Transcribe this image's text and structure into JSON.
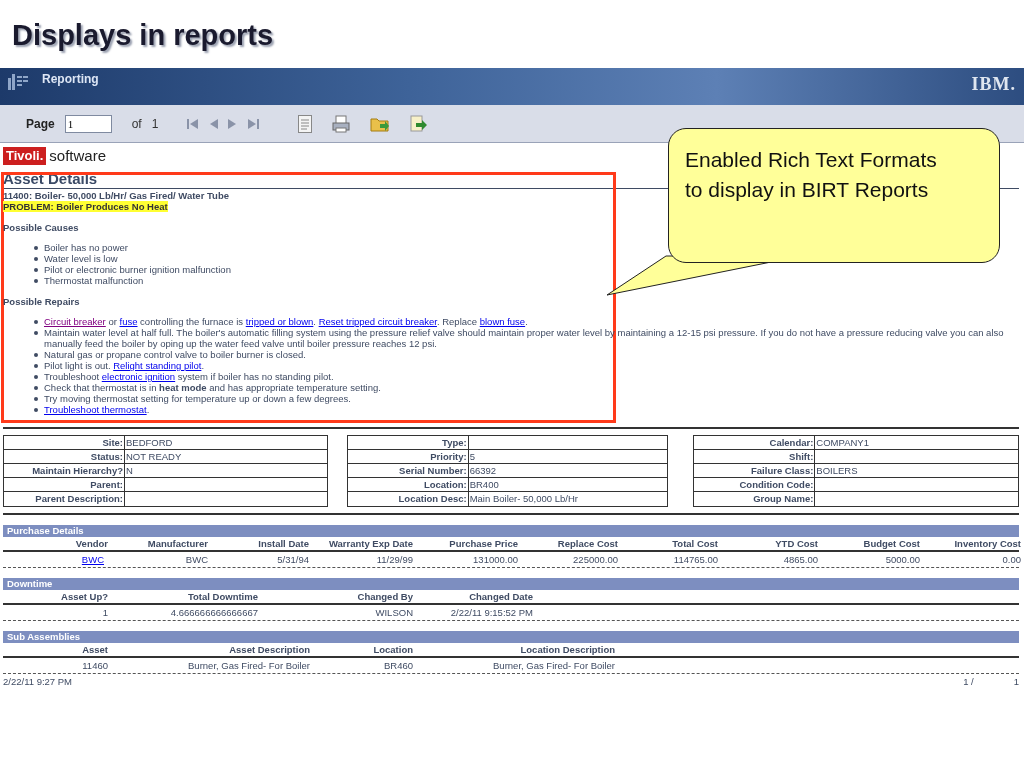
{
  "slide_title": "Displays in reports",
  "banner": {
    "title": "Reporting",
    "logo": "IBM."
  },
  "toolbar": {
    "page_label": "Page",
    "page_value": "1",
    "of_label": "of",
    "page_count": "1"
  },
  "report": {
    "brand": {
      "mark": "Tivoli.",
      "name": "software"
    },
    "title": "Asset Details",
    "asset": "11400: Boiler- 50,000 Lb/Hr/ Gas Fired/ Water Tube",
    "problem": "PROBLEM: Boiler Produces No Heat",
    "causes": {
      "heading": "Possible Causes",
      "items": [
        "Boiler has no power",
        "Water level is low",
        "Pilot or electronic burner ignition malfunction",
        "Thermostat malfunction"
      ]
    },
    "repairs": {
      "heading": "Possible Repairs",
      "items": [
        [
          {
            "kind": "link",
            "text": "Circuit breaker",
            "visited": true
          },
          {
            "kind": "text",
            "text": " or "
          },
          {
            "kind": "link",
            "text": "fuse",
            "visited": false
          },
          {
            "kind": "text",
            "text": " controlling the furnace is "
          },
          {
            "kind": "link",
            "text": "tripped or blown",
            "visited": false
          },
          {
            "kind": "text",
            "text": ". "
          },
          {
            "kind": "link",
            "text": "Reset tripped circuit breaker",
            "visited": false
          },
          {
            "kind": "text",
            "text": ". Replace "
          },
          {
            "kind": "link",
            "text": "blown fuse",
            "visited": false
          },
          {
            "kind": "text",
            "text": "."
          }
        ],
        [
          {
            "kind": "text",
            "text": "Maintain water level at half full. The boiler's automatic filling system using the pressure relief valve should maintain proper water level by maintaining a 12-15 psi pressure. If you do not have a pressure reducing valve you can also manually feed the boiler by oping up the water feed valve until boiler pressure reaches 12 psi."
          }
        ],
        [
          {
            "kind": "text",
            "text": "Natural gas or propane control valve to boiler burner is closed."
          }
        ],
        [
          {
            "kind": "text",
            "text": "Pilot light is out. "
          },
          {
            "kind": "link",
            "text": "Relight standing pilot",
            "visited": false
          },
          {
            "kind": "text",
            "text": "."
          }
        ],
        [
          {
            "kind": "text",
            "text": "Troubleshoot "
          },
          {
            "kind": "link",
            "text": "electronic ignition",
            "visited": false
          },
          {
            "kind": "text",
            "text": " system if boiler has no standing pilot."
          }
        ],
        [
          {
            "kind": "text",
            "text": "Check that thermostat is in "
          },
          {
            "kind": "bold",
            "text": "heat mode"
          },
          {
            "kind": "text",
            "text": " and has appropriate temperature setting."
          }
        ],
        [
          {
            "kind": "text",
            "text": "Try moving thermostat setting for temperature up or down a few degrees."
          }
        ],
        [
          {
            "kind": "link",
            "text": "Troubleshoot thermostat",
            "visited": false
          },
          {
            "kind": "text",
            "text": "."
          }
        ]
      ]
    },
    "fields": [
      [
        {
          "label": "Site:",
          "value": "BEDFORD"
        },
        {
          "label": "Status:",
          "value": "NOT READY"
        },
        {
          "label": "Maintain Hierarchy?",
          "value": "N"
        },
        {
          "label": "Parent:"
        },
        {
          "label": "Parent Description:"
        }
      ],
      [
        {
          "label": "Type:"
        },
        {
          "label": "Priority:",
          "value": "5"
        },
        {
          "label": "Serial Number:",
          "value": "66392"
        },
        {
          "label": "Location:",
          "value": "BR400"
        },
        {
          "label": "Location Desc:",
          "value": "Main Boiler- 50,000 Lb/Hr"
        }
      ],
      [
        {
          "label": "Calendar:",
          "value": "COMPANY1"
        },
        {
          "label": "Shift:"
        },
        {
          "label": "Failure Class:",
          "value": "BOILERS"
        },
        {
          "label": "Condition Code:"
        },
        {
          "label": "Group Name:"
        }
      ]
    ],
    "sections": [
      {
        "title": "Purchase Details",
        "columns": [
          {
            "label": "Vendor",
            "kind": "link"
          },
          {
            "label": "Manufacturer",
            "kind": "text"
          },
          {
            "label": "Install Date",
            "kind": "text"
          },
          {
            "label": "Warranty Exp Date",
            "kind": "text"
          },
          {
            "label": "Purchase Price",
            "kind": "text"
          },
          {
            "label": "Replace Cost",
            "kind": "text"
          },
          {
            "label": "Total Cost",
            "kind": "text"
          },
          {
            "label": "YTD Cost",
            "kind": "text"
          },
          {
            "label": "Budget Cost",
            "kind": "text"
          },
          {
            "label": "Inventory Cost",
            "kind": "text"
          }
        ],
        "rows": [
          [
            "BWC",
            "BWC",
            "5/31/94",
            "11/29/99",
            "131000.00",
            "225000.00",
            "114765.00",
            "4865.00",
            "5000.00",
            "0.00"
          ]
        ]
      },
      {
        "title": "Downtime",
        "columns": [
          {
            "label": "Asset Up?",
            "kind": "text"
          },
          {
            "label": "Total Downtime",
            "kind": "text"
          },
          {
            "label": "Changed By",
            "kind": "text"
          },
          {
            "label": "Changed Date",
            "kind": "text"
          }
        ],
        "rows": [
          [
            "1",
            "4.666666666666667",
            "WILSON",
            "2/22/11 9:15:52 PM"
          ]
        ]
      },
      {
        "title": "Sub Assemblies",
        "columns": [
          {
            "label": "Asset",
            "kind": "text"
          },
          {
            "label": "Asset Description",
            "kind": "text"
          },
          {
            "label": "Location",
            "kind": "text"
          },
          {
            "label": "Location Description",
            "kind": "text"
          }
        ],
        "rows": [
          [
            "11460",
            "Burner, Gas Fired- For Boiler",
            "BR460",
            "Burner, Gas Fired- For Boiler"
          ]
        ]
      }
    ],
    "footer": {
      "timestamp": "2/22/11 9:27 PM",
      "page": "1 /",
      "total": "1"
    }
  },
  "callout": {
    "text": "Enabled Rich Text Formats to display in BIRT Reports"
  }
}
